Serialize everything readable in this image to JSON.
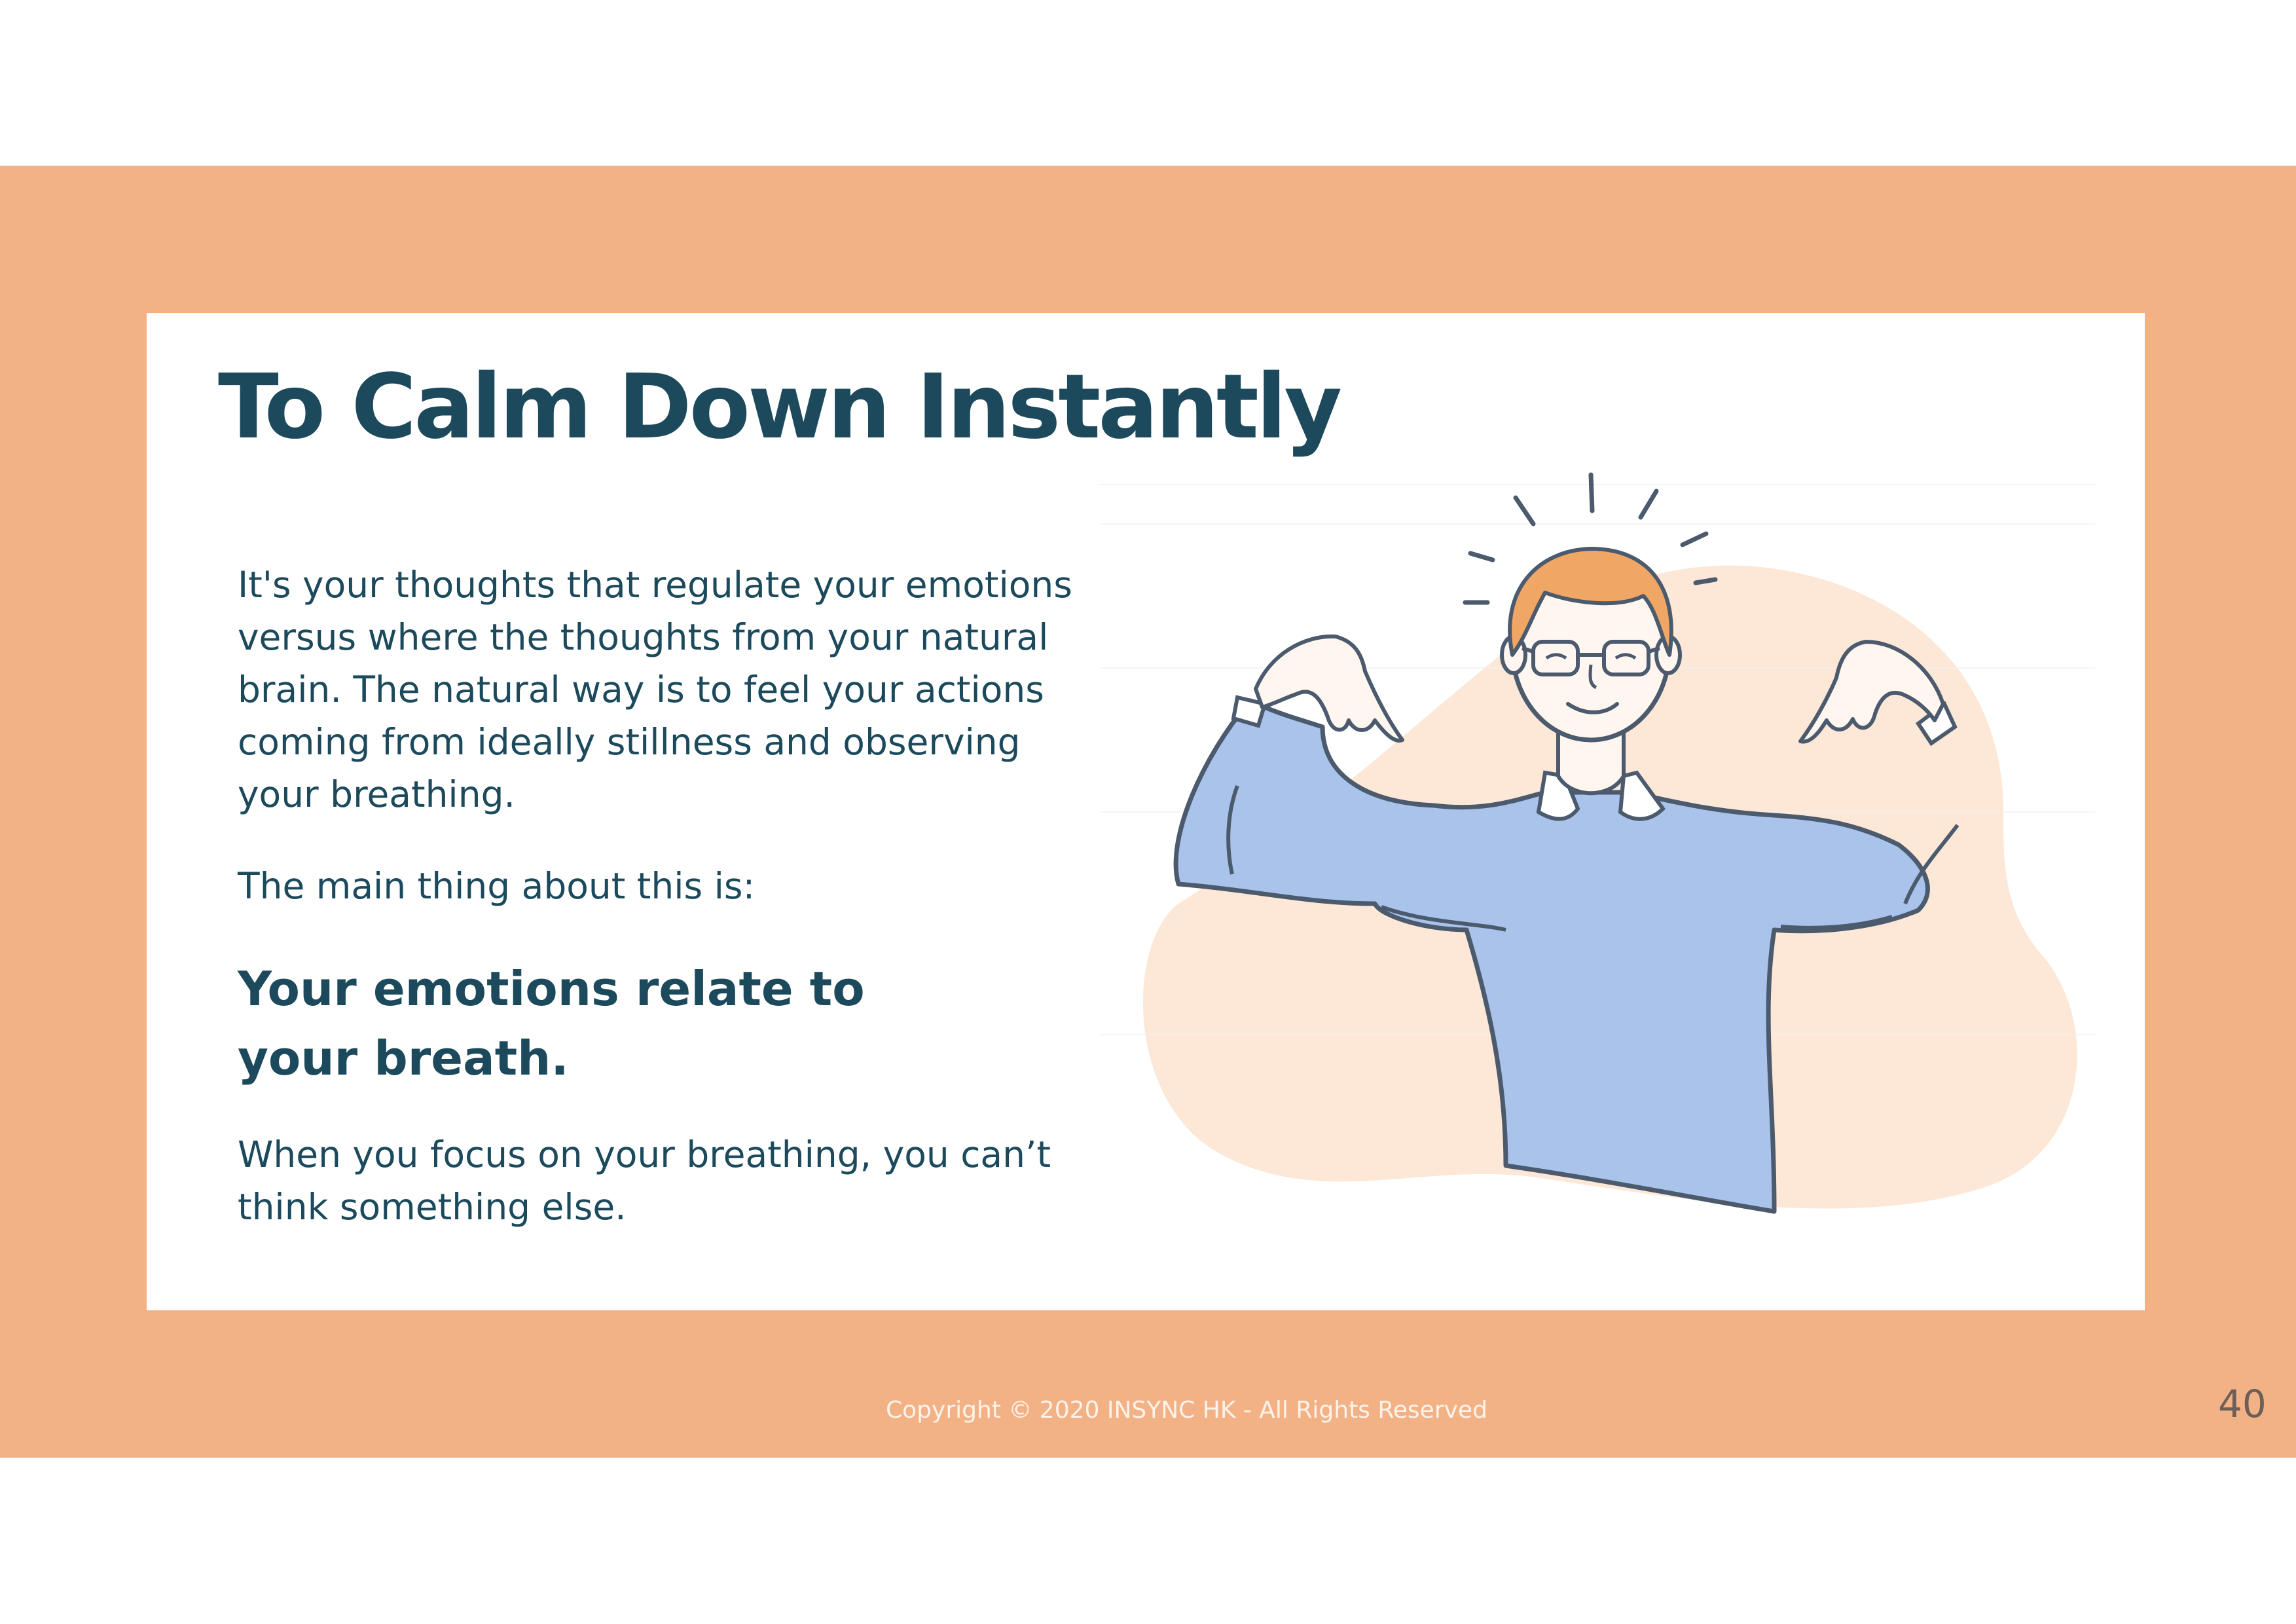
{
  "slide": {
    "title": "To Calm Down Instantly",
    "paragraph_1": "It's your thoughts that regulate your emotions versus where the thoughts from your natural brain. The natural way is to feel your actions coming from ideally stillness and observing your breathing.",
    "paragraph_2": "The main thing about this is:",
    "emphasis": "Your emotions relate to your breath.",
    "paragraph_3": "When you focus on your breathing, you can’t think something else."
  },
  "illustration": {
    "subject": "man in blue sweater pointing at himself"
  },
  "footer": {
    "copyright": "Copyright © 2020 INSYNC HK - All Rights Reserved",
    "page_number": "40"
  },
  "colors": {
    "band": "#f3b286",
    "title": "#1c4a5c",
    "blob": "#fde7d6",
    "sweater": "#a9c3ea",
    "hair": "#f0a765",
    "outline": "#4c5a6e"
  }
}
